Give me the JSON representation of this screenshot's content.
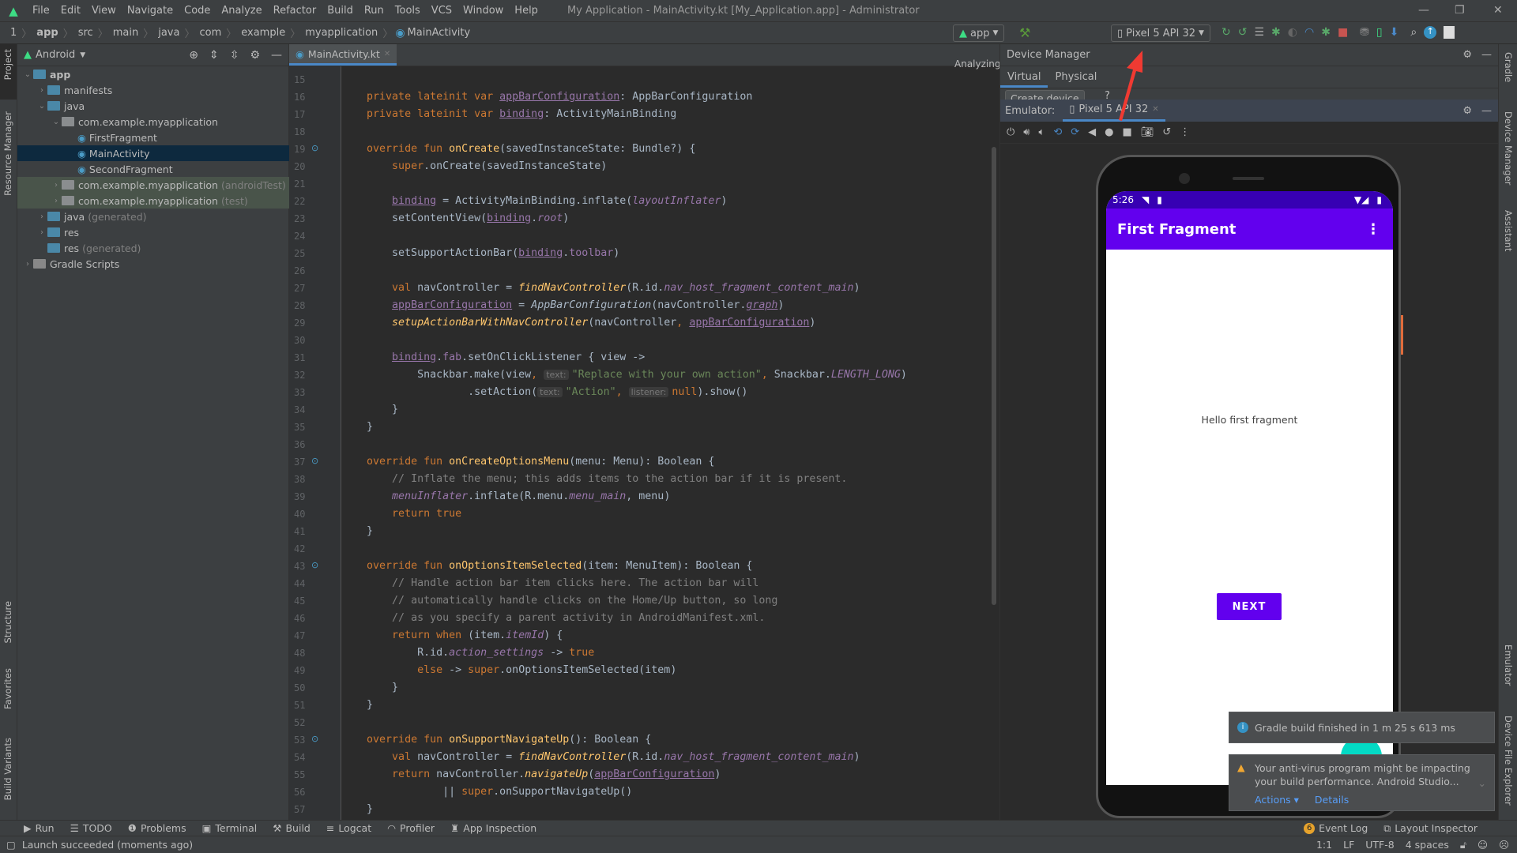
{
  "menubar": {
    "items": [
      "File",
      "Edit",
      "View",
      "Navigate",
      "Code",
      "Analyze",
      "Refactor",
      "Build",
      "Run",
      "Tools",
      "VCS",
      "Window",
      "Help"
    ],
    "title": "My Application - MainActivity.kt [My_Application.app] - Administrator"
  },
  "breadcrumb": [
    "1",
    "app",
    "src",
    "main",
    "java",
    "com",
    "example",
    "myapplication",
    "MainActivity"
  ],
  "toolbar": {
    "run_config": "app",
    "device": "Pixel 5 API 32"
  },
  "project": {
    "view": "Android",
    "tree": [
      {
        "label": "app",
        "depth": 0,
        "open": "v",
        "bold": true
      },
      {
        "label": "manifests",
        "depth": 1,
        "open": ">"
      },
      {
        "label": "java",
        "depth": 1,
        "open": "v"
      },
      {
        "label": "com.example.myapplication",
        "depth": 2,
        "open": "v"
      },
      {
        "label": "FirstFragment",
        "depth": 3,
        "kt": true
      },
      {
        "label": "MainActivity",
        "depth": 3,
        "kt": true,
        "selected": true
      },
      {
        "label": "SecondFragment",
        "depth": 3,
        "kt": true
      },
      {
        "label": "com.example.myapplication",
        "suffix": "(androidTest)",
        "depth": 2,
        "open": ">",
        "test": true
      },
      {
        "label": "com.example.myapplication",
        "suffix": "(test)",
        "depth": 2,
        "open": ">",
        "test": true
      },
      {
        "label": "java",
        "suffix": "(generated)",
        "depth": 1,
        "open": ">"
      },
      {
        "label": "res",
        "depth": 1,
        "open": ">"
      },
      {
        "label": "res",
        "suffix": "(generated)",
        "depth": 1
      },
      {
        "label": "Gradle Scripts",
        "depth": 0,
        "open": ">"
      }
    ]
  },
  "left_strip": [
    "Project",
    "Resource Manager",
    "Structure",
    "Favorites",
    "Build Variants"
  ],
  "right_strip": [
    "Gradle",
    "Device Manager",
    "Assistant",
    "Emulator",
    "Device File Explorer"
  ],
  "editor": {
    "tab": "MainActivity.kt",
    "status": "Analyzing...",
    "first_line": 15,
    "lines": [
      [],
      [
        [
          "    "
        ],
        [
          "private lateinit var ",
          "kw"
        ],
        [
          "appBarConfiguration",
          "u"
        ],
        [
          ": AppBarConfiguration"
        ]
      ],
      [
        [
          "    "
        ],
        [
          "private lateinit var ",
          "kw"
        ],
        [
          "binding",
          "u"
        ],
        [
          ": ActivityMainBinding"
        ]
      ],
      [],
      [
        [
          "    "
        ],
        [
          "override fun ",
          "kw"
        ],
        [
          "onCreate",
          "fn"
        ],
        [
          "(savedInstanceState: Bundle?) {"
        ]
      ],
      [
        [
          "        "
        ],
        [
          "super",
          "kw"
        ],
        [
          ".onCreate(savedInstanceState)"
        ]
      ],
      [],
      [
        [
          "        "
        ],
        [
          "binding",
          "u"
        ],
        [
          " = ActivityMainBinding.inflate("
        ],
        [
          "layoutInflater",
          "pi"
        ],
        [
          ")"
        ]
      ],
      [
        [
          "        setContentView("
        ],
        [
          "binding",
          "u"
        ],
        [
          "."
        ],
        [
          "root",
          "pi"
        ],
        [
          ")"
        ]
      ],
      [],
      [
        [
          "        setSupportActionBar("
        ],
        [
          "binding",
          "u"
        ],
        [
          "."
        ],
        [
          "toolbar",
          "pr"
        ],
        [
          ")"
        ]
      ],
      [],
      [
        [
          "        "
        ],
        [
          "val ",
          "kw"
        ],
        [
          "navController = "
        ],
        [
          "findNavController",
          "fi"
        ],
        [
          "(R.id."
        ],
        [
          "nav_host_fragment_content_main",
          "pi"
        ],
        [
          ")"
        ]
      ],
      [
        [
          "        "
        ],
        [
          "appBarConfiguration",
          "u"
        ],
        [
          " = "
        ],
        [
          "AppBarConfiguration",
          "it"
        ],
        [
          "(navController."
        ],
        [
          "graph",
          "piu"
        ],
        [
          ")"
        ]
      ],
      [
        [
          "        "
        ],
        [
          "setupActionBarWithNavController",
          "fi"
        ],
        [
          "(navController"
        ],
        [
          ", ",
          "kw"
        ],
        [
          "appBarConfiguration",
          "u"
        ],
        [
          ")"
        ]
      ],
      [],
      [
        [
          "        "
        ],
        [
          "binding",
          "u"
        ],
        [
          "."
        ],
        [
          "fab",
          "pr"
        ],
        [
          ".setOnClickListener { view ->"
        ]
      ],
      [
        [
          "            Snackbar.make(view"
        ],
        [
          ", ",
          "kw"
        ],
        [
          "text:",
          "hint"
        ],
        [
          "\"Replace with your own action\"",
          "str"
        ],
        [
          ", ",
          "kw"
        ],
        [
          "Snackbar."
        ],
        [
          "LENGTH_LONG",
          "pi"
        ],
        [
          ")"
        ]
      ],
      [
        [
          "                    .setAction("
        ],
        [
          "text:",
          "hint"
        ],
        [
          "\"Action\"",
          "str"
        ],
        [
          ", ",
          "kw"
        ],
        [
          "listener:",
          "hint"
        ],
        [
          "null",
          "kw"
        ],
        [
          ").show()"
        ]
      ],
      [
        [
          "        }"
        ]
      ],
      [
        [
          "    }"
        ]
      ],
      [],
      [
        [
          "    "
        ],
        [
          "override fun ",
          "kw"
        ],
        [
          "onCreateOptionsMenu",
          "fn"
        ],
        [
          "(menu: Menu): Boolean {"
        ]
      ],
      [
        [
          "        "
        ],
        [
          "// Inflate the menu; this adds items to the action bar if it is present.",
          "cm"
        ]
      ],
      [
        [
          "        "
        ],
        [
          "menuInflater",
          "pi"
        ],
        [
          ".inflate(R.menu."
        ],
        [
          "menu_main",
          "pi"
        ],
        [
          ", menu)"
        ]
      ],
      [
        [
          "        "
        ],
        [
          "return true",
          "kw"
        ]
      ],
      [
        [
          "    }"
        ]
      ],
      [],
      [
        [
          "    "
        ],
        [
          "override fun ",
          "kw"
        ],
        [
          "onOptionsItemSelected",
          "fn"
        ],
        [
          "(item: MenuItem): Boolean {"
        ]
      ],
      [
        [
          "        "
        ],
        [
          "// Handle action bar item clicks here. The action bar will",
          "cm"
        ]
      ],
      [
        [
          "        "
        ],
        [
          "// automatically handle clicks on the Home/Up button, so long",
          "cm"
        ]
      ],
      [
        [
          "        "
        ],
        [
          "// as you specify a parent activity in AndroidManifest.xml.",
          "cm"
        ]
      ],
      [
        [
          "        "
        ],
        [
          "return when ",
          "kw"
        ],
        [
          "(item."
        ],
        [
          "itemId",
          "pi"
        ],
        [
          ") {"
        ]
      ],
      [
        [
          "            R.id."
        ],
        [
          "action_settings",
          "pi"
        ],
        [
          " -> "
        ],
        [
          "true",
          "kw"
        ]
      ],
      [
        [
          "            "
        ],
        [
          "else ",
          "kw"
        ],
        [
          "-> "
        ],
        [
          "super",
          "kw"
        ],
        [
          ".onOptionsItemSelected(item)"
        ]
      ],
      [
        [
          "        }"
        ]
      ],
      [
        [
          "    }"
        ]
      ],
      [],
      [
        [
          "    "
        ],
        [
          "override fun ",
          "kw"
        ],
        [
          "onSupportNavigateUp",
          "fn"
        ],
        [
          "(): Boolean {"
        ]
      ],
      [
        [
          "        "
        ],
        [
          "val ",
          "kw"
        ],
        [
          "navController = "
        ],
        [
          "findNavController",
          "fi"
        ],
        [
          "(R.id."
        ],
        [
          "nav_host_fragment_content_main",
          "pi"
        ],
        [
          ")"
        ]
      ],
      [
        [
          "        "
        ],
        [
          "return ",
          "kw"
        ],
        [
          "navController."
        ],
        [
          "navigateUp",
          "fi"
        ],
        [
          "("
        ],
        [
          "appBarConfiguration",
          "u"
        ],
        [
          ")"
        ]
      ],
      [
        [
          "                || "
        ],
        [
          "super",
          "kw"
        ],
        [
          ".onSupportNavigateUp()"
        ]
      ],
      [
        [
          "    }"
        ]
      ]
    ]
  },
  "device_manager": {
    "title": "Device Manager",
    "tabs": [
      "Virtual",
      "Physical"
    ],
    "active_tab": "Virtual",
    "create_device": "Create device",
    "help": "?"
  },
  "emulator": {
    "label": "Emulator:",
    "tab": "Pixel 5 API 32"
  },
  "phone": {
    "time": "5:26",
    "app_title": "First Fragment",
    "body_text": "Hello first fragment",
    "button": "NEXT",
    "accent": "#6200ee",
    "status_color": "#3700b3"
  },
  "notifications": {
    "gradle": "Gradle build finished in 1 m 25 s 613 ms",
    "antivirus_line1": "Your anti-virus program might be impacting",
    "antivirus_line2": "your build performance. Android Studio...",
    "actions": "Actions",
    "details": "Details"
  },
  "tool_windows": [
    "Run",
    "TODO",
    "Problems",
    "Terminal",
    "Build",
    "Logcat",
    "Profiler",
    "App Inspection"
  ],
  "tool_windows_right": {
    "event_log": "Event Log",
    "event_count": "6",
    "layout_inspector": "Layout Inspector"
  },
  "status": {
    "message": "Launch succeeded (moments ago)",
    "position": "1:1",
    "line_sep": "LF",
    "encoding": "UTF-8",
    "indent": "4 spaces"
  }
}
